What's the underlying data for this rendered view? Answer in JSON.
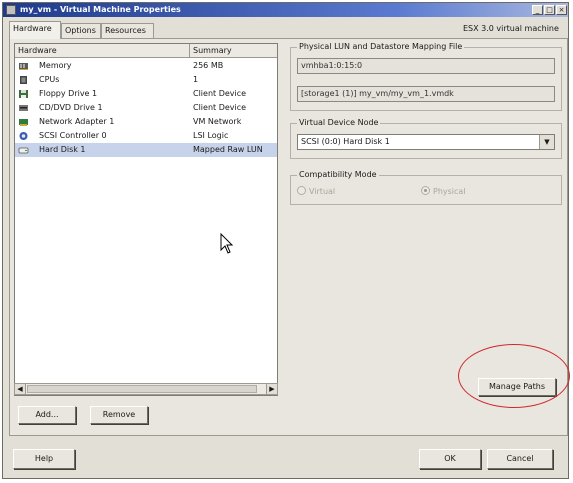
{
  "window": {
    "title": "my_vm - Virtual Machine Properties",
    "controls": {
      "minimize": "_",
      "maximize": "□",
      "close": "×"
    }
  },
  "tabs": [
    {
      "label": "Hardware",
      "active": true
    },
    {
      "label": "Options",
      "active": false
    },
    {
      "label": "Resources",
      "active": false
    }
  ],
  "host_version": "ESX 3.0 virtual machine",
  "hardware_table": {
    "columns": [
      "Hardware",
      "Summary"
    ],
    "rows": [
      {
        "name": "Memory",
        "summary": "256 MB",
        "icon": "memory-icon"
      },
      {
        "name": "CPUs",
        "summary": "1",
        "icon": "cpu-icon"
      },
      {
        "name": "Floppy Drive 1",
        "summary": "Client Device",
        "icon": "floppy-icon"
      },
      {
        "name": "CD/DVD Drive 1",
        "summary": "Client Device",
        "icon": "cdrom-icon"
      },
      {
        "name": "Network Adapter 1",
        "summary": "VM Network",
        "icon": "network-adapter-icon"
      },
      {
        "name": "SCSI Controller 0",
        "summary": "LSI Logic",
        "icon": "scsi-controller-icon"
      },
      {
        "name": "Hard Disk 1",
        "summary": "Mapped Raw LUN",
        "icon": "hard-disk-icon",
        "selected": true
      }
    ]
  },
  "buttons": {
    "add": "Add...",
    "remove": "Remove",
    "manage_paths": "Manage Paths",
    "help": "Help",
    "ok": "OK",
    "cancel": "Cancel"
  },
  "lun_mapping": {
    "label": "Physical LUN and Datastore Mapping File",
    "lun_path": "vmhba1:0:15:0",
    "mapping_file": "[storage1 (1)] my_vm/my_vm_1.vmdk"
  },
  "virtual_device_node": {
    "label": "Virtual Device Node",
    "selected": "SCSI (0:0) Hard Disk 1"
  },
  "compatibility_mode": {
    "label": "Compatibility Mode",
    "options": [
      {
        "label": "Virtual",
        "checked": false
      },
      {
        "label": "Physical",
        "checked": true
      }
    ]
  },
  "colors": {
    "titlebar": "#1f3a8a",
    "selection": "#c6d3ea",
    "highlight_circle": "#d0282e"
  }
}
